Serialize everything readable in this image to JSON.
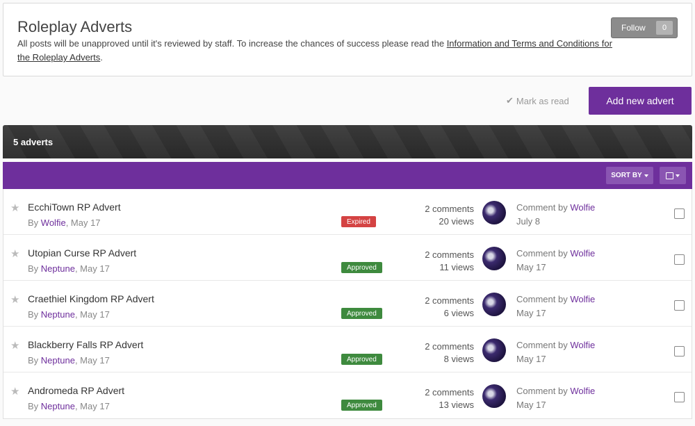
{
  "header": {
    "title": "Roleplay Adverts",
    "description_prefix": "All posts will be unapproved until it's reviewed by staff. To increase the chances of success please read the ",
    "description_link": "Information and Terms and Conditions for the Roleplay Adverts",
    "description_suffix": ".",
    "follow_label": "Follow",
    "follow_count": "0"
  },
  "actions": {
    "mark_read_label": "Mark as read",
    "add_label": "Add new advert"
  },
  "list_header": {
    "count_label": "5 adverts",
    "sort_label": "SORT BY"
  },
  "rows": [
    {
      "title": "EcchiTown RP Advert",
      "by": "By ",
      "author": "Wolfie",
      "date": ", May 17",
      "badge": "Expired",
      "comments": "2 comments",
      "views": "20 views",
      "last_prefix": "Comment by ",
      "last_author": "Wolfie",
      "last_date": "July 8"
    },
    {
      "title": "Utopian Curse RP Advert",
      "by": "By ",
      "author": "Neptune",
      "date": ", May 17",
      "badge": "Approved",
      "comments": "2 comments",
      "views": "11 views",
      "last_prefix": "Comment by ",
      "last_author": "Wolfie",
      "last_date": "May 17"
    },
    {
      "title": "Craethiel Kingdom RP Advert",
      "by": "By ",
      "author": "Neptune",
      "date": ", May 17",
      "badge": "Approved",
      "comments": "2 comments",
      "views": "6 views",
      "last_prefix": "Comment by ",
      "last_author": "Wolfie",
      "last_date": "May 17"
    },
    {
      "title": "Blackberry Falls RP Advert",
      "by": "By ",
      "author": "Neptune",
      "date": ", May 17",
      "badge": "Approved",
      "comments": "2 comments",
      "views": "8 views",
      "last_prefix": "Comment by ",
      "last_author": "Wolfie",
      "last_date": "May 17"
    },
    {
      "title": "Andromeda RP Advert",
      "by": "By ",
      "author": "Neptune",
      "date": ", May 17",
      "badge": "Approved",
      "comments": "2 comments",
      "views": "13 views",
      "last_prefix": "Comment by ",
      "last_author": "Wolfie",
      "last_date": "May 17"
    }
  ],
  "colors": {
    "accent": "#6e2f9c",
    "expired": "#d44343",
    "approved": "#3e8a3e"
  }
}
